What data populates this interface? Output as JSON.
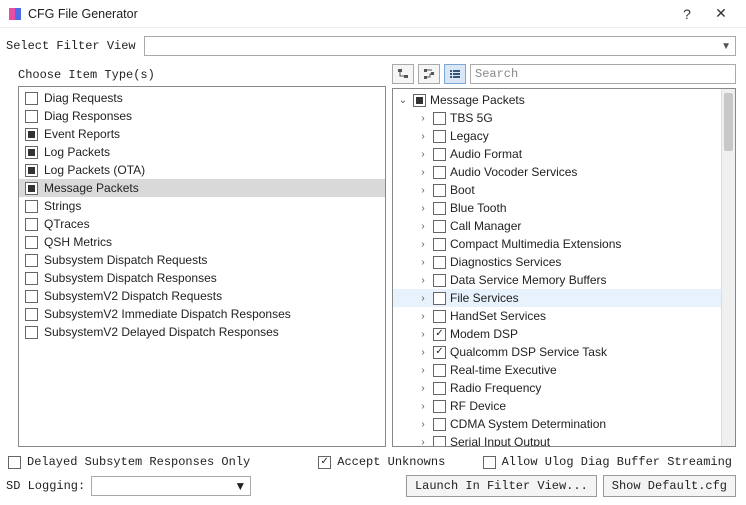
{
  "window": {
    "title": "CFG File Generator"
  },
  "filter": {
    "label": "Select Filter View"
  },
  "left": {
    "header": "Choose Item Type(s)",
    "items": [
      {
        "label": "Diag Requests",
        "state": "unchecked",
        "selected": false
      },
      {
        "label": "Diag Responses",
        "state": "unchecked",
        "selected": false
      },
      {
        "label": "Event Reports",
        "state": "tri",
        "selected": false
      },
      {
        "label": "Log Packets",
        "state": "tri",
        "selected": false
      },
      {
        "label": "Log Packets (OTA)",
        "state": "tri",
        "selected": false
      },
      {
        "label": "Message Packets",
        "state": "tri",
        "selected": true
      },
      {
        "label": "Strings",
        "state": "unchecked",
        "selected": false
      },
      {
        "label": "QTraces",
        "state": "unchecked",
        "selected": false
      },
      {
        "label": "QSH Metrics",
        "state": "unchecked",
        "selected": false
      },
      {
        "label": "Subsystem Dispatch Requests",
        "state": "unchecked",
        "selected": false
      },
      {
        "label": "Subsystem Dispatch Responses",
        "state": "unchecked",
        "selected": false
      },
      {
        "label": "SubsystemV2 Dispatch Requests",
        "state": "unchecked",
        "selected": false
      },
      {
        "label": "SubsystemV2 Immediate Dispatch Responses",
        "state": "unchecked",
        "selected": false
      },
      {
        "label": "SubsystemV2 Delayed Dispatch Responses",
        "state": "unchecked",
        "selected": false
      }
    ]
  },
  "right_toolbar": {
    "btn1_title": "tree-view",
    "btn2_title": "tree-view-alt",
    "btn3_title": "list-view",
    "search_placeholder": "Search"
  },
  "tree": {
    "root_state": "tri",
    "root_label": "Message Packets",
    "children": [
      {
        "label": "TBS 5G",
        "state": "unchecked"
      },
      {
        "label": "Legacy",
        "state": "unchecked"
      },
      {
        "label": "Audio Format",
        "state": "unchecked"
      },
      {
        "label": "Audio Vocoder Services",
        "state": "unchecked"
      },
      {
        "label": "Boot",
        "state": "unchecked"
      },
      {
        "label": "Blue Tooth",
        "state": "unchecked"
      },
      {
        "label": "Call Manager",
        "state": "unchecked"
      },
      {
        "label": "Compact Multimedia Extensions",
        "state": "unchecked"
      },
      {
        "label": "Diagnostics Services",
        "state": "unchecked"
      },
      {
        "label": "Data Service Memory Buffers",
        "state": "unchecked"
      },
      {
        "label": "File Services",
        "state": "unchecked",
        "hl": true
      },
      {
        "label": "HandSet Services",
        "state": "unchecked"
      },
      {
        "label": "Modem DSP",
        "state": "checked"
      },
      {
        "label": "Qualcomm DSP Service Task",
        "state": "checked"
      },
      {
        "label": "Real-time Executive",
        "state": "unchecked"
      },
      {
        "label": "Radio Frequency",
        "state": "unchecked"
      },
      {
        "label": "RF Device",
        "state": "unchecked"
      },
      {
        "label": "CDMA System Determination",
        "state": "unchecked"
      },
      {
        "label": "Serial Input Output",
        "state": "unchecked"
      }
    ]
  },
  "bottom": {
    "delayed_label": "Delayed Subsytem Responses Only",
    "accept_label": "Accept Unknowns",
    "allow_label": "Allow Ulog Diag Buffer Streaming",
    "sd_label": "SD Logging:",
    "launch_label": "Launch In Filter View...",
    "default_label": "Show Default.cfg",
    "delayed_checked": false,
    "accept_checked": true,
    "allow_checked": false
  }
}
